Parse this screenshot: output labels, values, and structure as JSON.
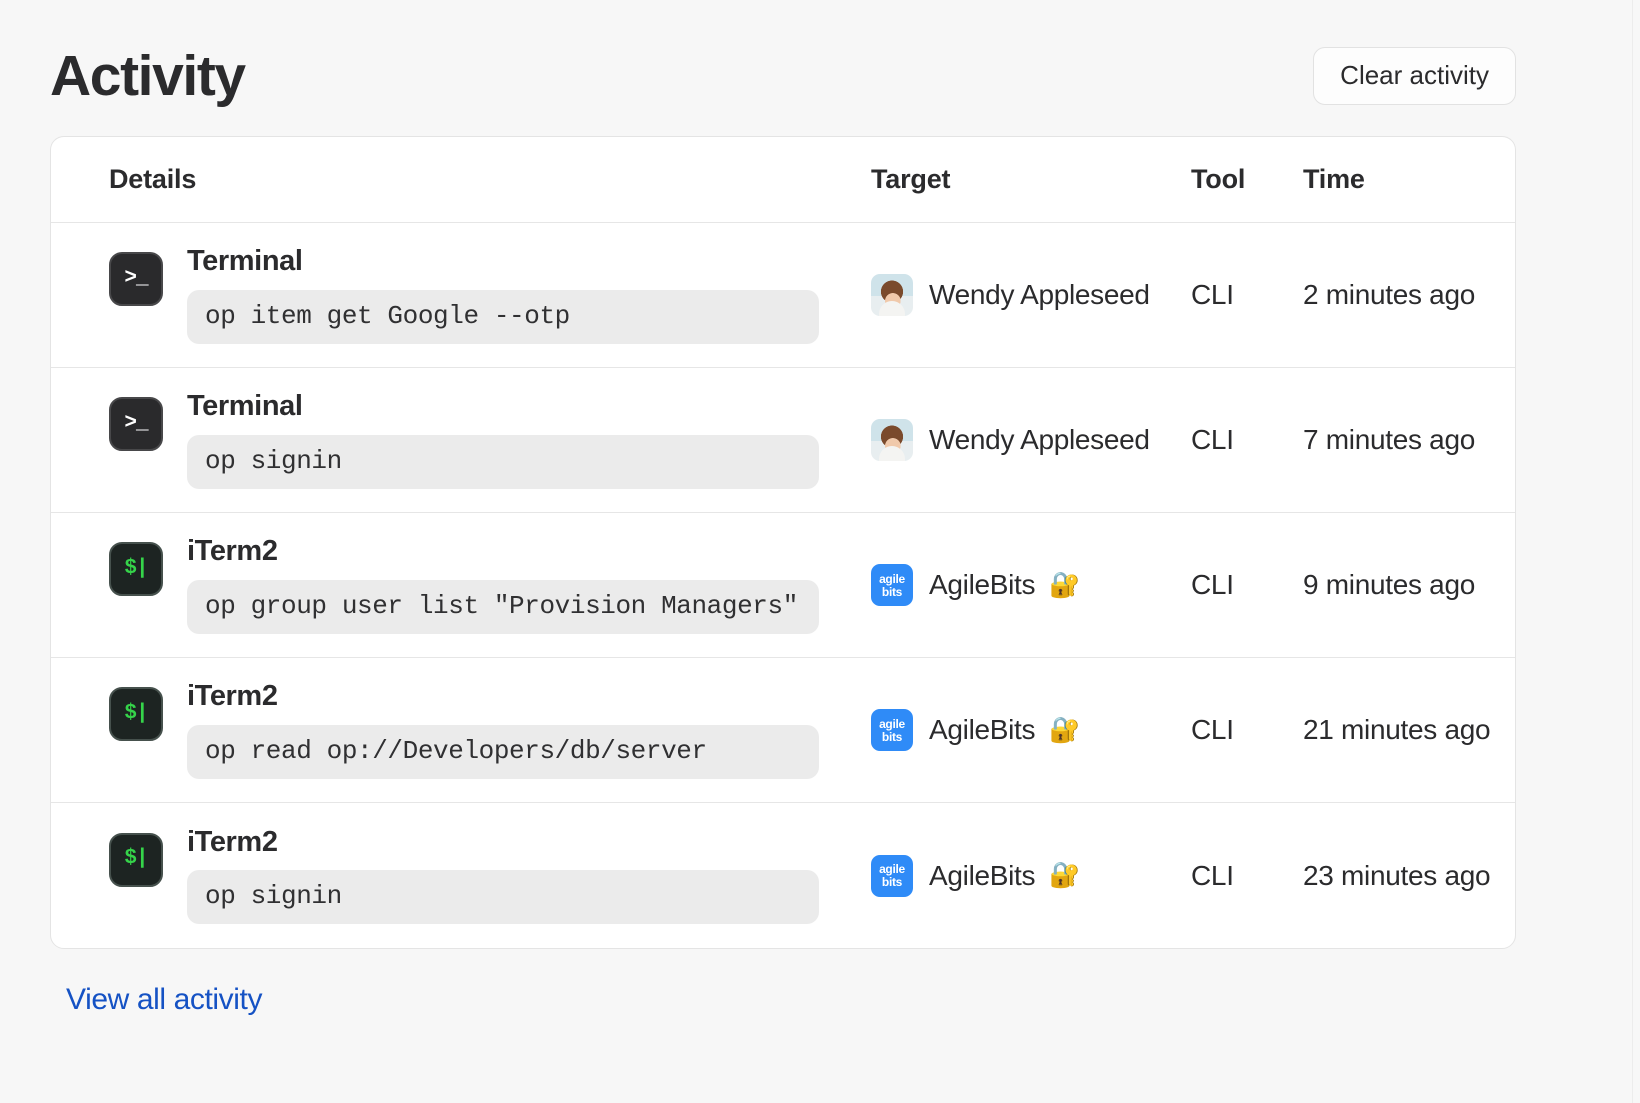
{
  "header": {
    "title": "Activity",
    "clear_button_label": "Clear activity"
  },
  "table": {
    "columns": {
      "details": "Details",
      "target": "Target",
      "tool": "Tool",
      "time": "Time"
    },
    "rows": [
      {
        "app": "Terminal",
        "app_icon": "terminal-icon",
        "app_icon_glyph": ">_",
        "command": "op item get Google --otp",
        "target_name": "Wendy Appleseed",
        "target_icon": "person-avatar",
        "target_badge": "",
        "tool": "CLI",
        "time": "2 minutes ago"
      },
      {
        "app": "Terminal",
        "app_icon": "terminal-icon",
        "app_icon_glyph": ">_",
        "command": "op signin",
        "target_name": "Wendy Appleseed",
        "target_icon": "person-avatar",
        "target_badge": "",
        "tool": "CLI",
        "time": "7 minutes ago"
      },
      {
        "app": "iTerm2",
        "app_icon": "iterm2-icon",
        "app_icon_glyph": "$|",
        "command": "op group user list \"Provision Managers\"",
        "target_name": "AgileBits",
        "target_icon": "agilebits-logo",
        "target_badge": "🔐",
        "tool": "CLI",
        "time": "9 minutes ago"
      },
      {
        "app": "iTerm2",
        "app_icon": "iterm2-icon",
        "app_icon_glyph": "$|",
        "command": "op read op://Developers/db/server",
        "target_name": "AgileBits",
        "target_icon": "agilebits-logo",
        "target_badge": "🔐",
        "tool": "CLI",
        "time": "21 minutes ago"
      },
      {
        "app": "iTerm2",
        "app_icon": "iterm2-icon",
        "app_icon_glyph": "$|",
        "command": "op signin",
        "target_name": "AgileBits",
        "target_icon": "agilebits-logo",
        "target_badge": "🔐",
        "tool": "CLI",
        "time": "23 minutes ago"
      }
    ]
  },
  "brand_logo": {
    "line1": "agile",
    "line2": "bits"
  },
  "footer": {
    "view_all_label": "View all activity"
  },
  "colors": {
    "page_background": "#f7f7f7",
    "card_background": "#ffffff",
    "border": "#e6e6e6",
    "text": "#2b2b2d",
    "link": "#1552c4",
    "command_pill": "#ebebeb",
    "brand_blue": "#2f8bf7",
    "terminal_icon_bg": "#2a2a2c",
    "iterm_icon_bg": "#1d2422",
    "iterm_prompt_green": "#35d44a"
  }
}
